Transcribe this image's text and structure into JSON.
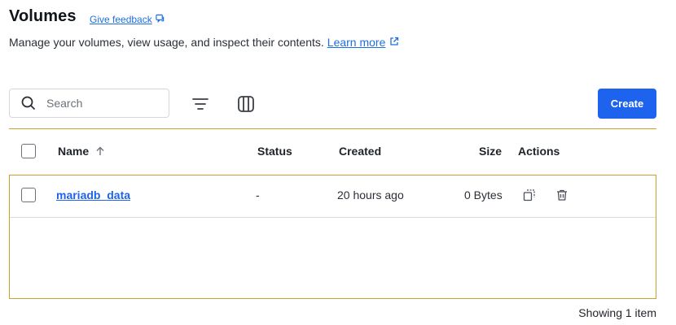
{
  "header": {
    "title": "Volumes",
    "feedback_label": "Give feedback",
    "subtitle": "Manage your volumes, view usage, and inspect their contents.",
    "learn_more_label": "Learn more"
  },
  "toolbar": {
    "search_placeholder": "Search",
    "search_value": "",
    "create_label": "Create"
  },
  "table": {
    "columns": {
      "name": "Name",
      "status": "Status",
      "created": "Created",
      "size": "Size",
      "actions": "Actions"
    },
    "sort": {
      "column": "name",
      "direction": "ascending"
    },
    "rows": [
      {
        "name": "mariadb_data",
        "status": "-",
        "created": "20 hours ago",
        "size": "0 Bytes"
      }
    ]
  },
  "footer": {
    "count_text": "Showing 1 item"
  },
  "colors": {
    "accent": "#1d63ed",
    "link": "#1d6fe0",
    "highlight_border": "#c9a227"
  },
  "icons": [
    "external-link-icon",
    "search-icon",
    "filter-icon",
    "columns-icon",
    "sort-up-icon",
    "copy-icon",
    "trash-icon"
  ]
}
